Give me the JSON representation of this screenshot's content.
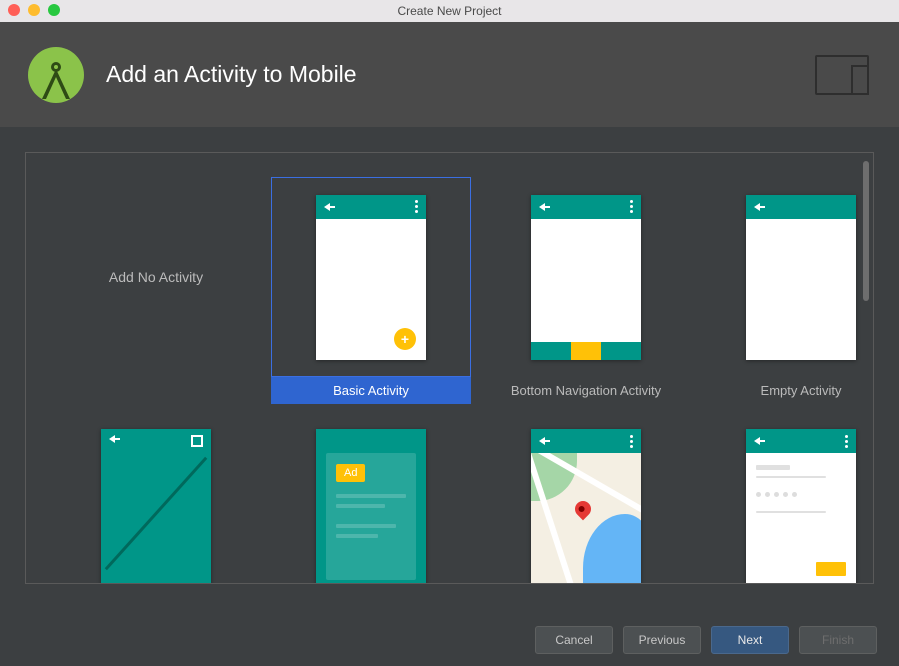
{
  "window": {
    "title": "Create New Project"
  },
  "header": {
    "title": "Add an Activity to Mobile"
  },
  "templates": [
    {
      "label": "Add No Activity"
    },
    {
      "label": "Basic Activity"
    },
    {
      "label": "Bottom Navigation Activity"
    },
    {
      "label": "Empty Activity"
    },
    {
      "label": ""
    },
    {
      "label": ""
    },
    {
      "label": ""
    },
    {
      "label": ""
    }
  ],
  "ad_label": "Ad",
  "footer": {
    "cancel": "Cancel",
    "previous": "Previous",
    "next": "Next",
    "finish": "Finish"
  }
}
